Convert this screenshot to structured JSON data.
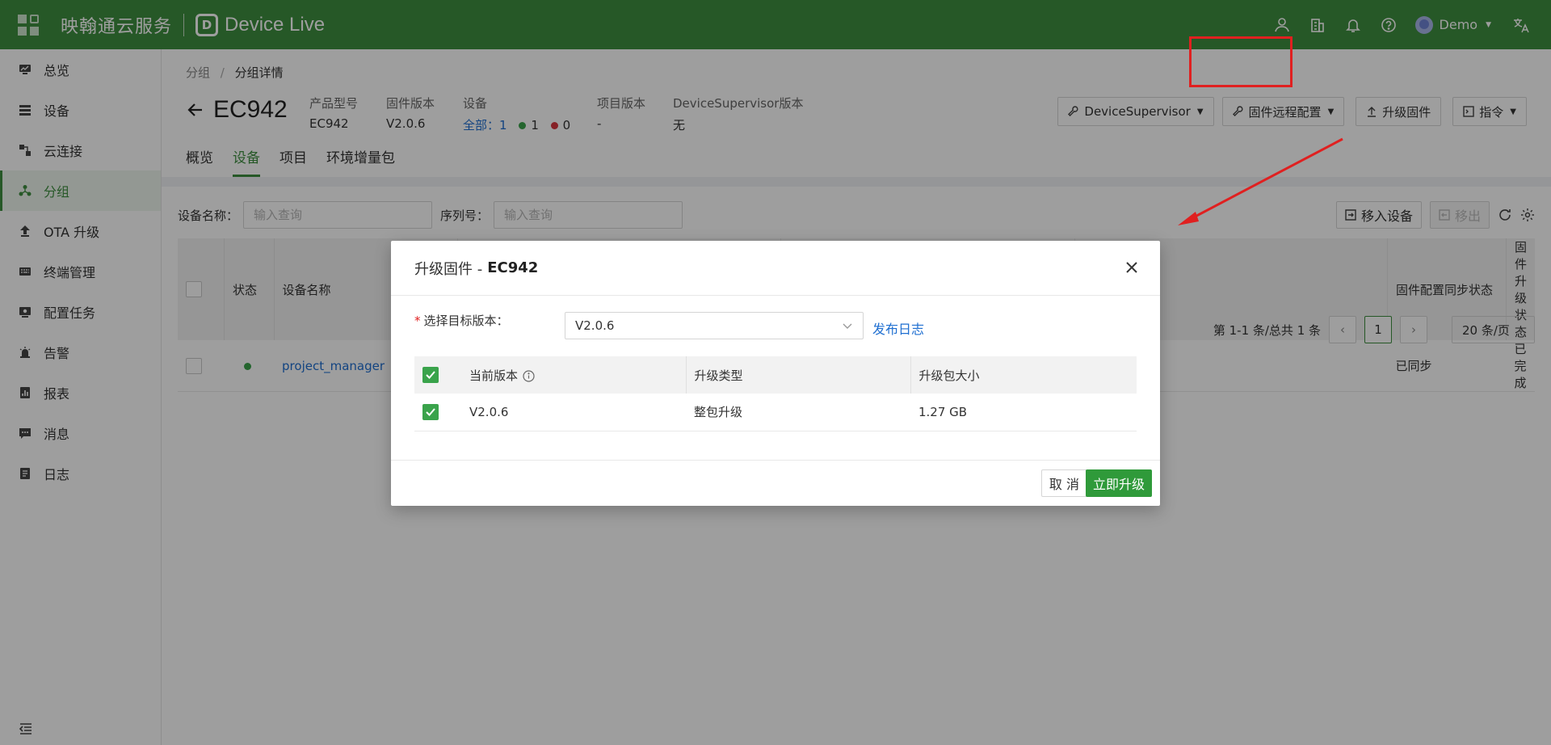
{
  "header": {
    "brand": "映翰通云服务",
    "logo_letter": "D",
    "product": "Device Live",
    "user": "Demo"
  },
  "sidebar": {
    "items": [
      {
        "label": "总览",
        "icon": "monitor-icon"
      },
      {
        "label": "设备",
        "icon": "server-icon"
      },
      {
        "label": "云连接",
        "icon": "link-icon"
      },
      {
        "label": "分组",
        "icon": "group-icon"
      },
      {
        "label": "OTA 升级",
        "icon": "upload-icon"
      },
      {
        "label": "终端管理",
        "icon": "keyboard-icon"
      },
      {
        "label": "配置任务",
        "icon": "config-icon"
      },
      {
        "label": "告警",
        "icon": "alarm-icon"
      },
      {
        "label": "报表",
        "icon": "report-icon"
      },
      {
        "label": "消息",
        "icon": "message-icon"
      },
      {
        "label": "日志",
        "icon": "log-icon"
      }
    ],
    "active_index": 3
  },
  "breadcrumb": {
    "parent": "分组",
    "current": "分组详情"
  },
  "page": {
    "title": "EC942",
    "meta": {
      "model_label": "产品型号",
      "model_value": "EC942",
      "fw_label": "固件版本",
      "fw_value": "V2.0.6",
      "device_label": "设备",
      "device_all": "全部：1",
      "device_online": "1",
      "device_offline": "0",
      "project_label": "项目版本",
      "project_value": "-",
      "ds_label": "DeviceSupervisor版本",
      "ds_value": "无"
    },
    "actions": {
      "device_supervisor": "DeviceSupervisor",
      "remote_config": "固件远程配置",
      "upgrade": "升级固件",
      "command": "指令"
    },
    "tabs": [
      "概览",
      "设备",
      "项目",
      "环境增量包"
    ],
    "active_tab": 1
  },
  "filters": {
    "name_label": "设备名称：",
    "name_placeholder": "输入查询",
    "sn_label": "序列号：",
    "sn_placeholder": "输入查询",
    "move_in": "移入设备",
    "move_out": "移出"
  },
  "table": {
    "headers": {
      "status": "状态",
      "name": "设备名称",
      "fw_sync": "固件配置同步状态",
      "fw_upgrade": "固件升级状态"
    },
    "rows": [
      {
        "name": "project_manager",
        "fw_sync": "已同步",
        "fw_upgrade": "已完成"
      }
    ]
  },
  "pager": {
    "summary": "第 1-1 条/总共 1 条",
    "page": "1",
    "size": "20 条/页"
  },
  "modal": {
    "title_prefix": "升级固件 -",
    "title_device": "EC942",
    "target_label": "选择目标版本：",
    "target_value": "V2.0.6",
    "release_log": "发布日志",
    "headers": {
      "current": "当前版本",
      "type": "升级类型",
      "size": "升级包大小"
    },
    "rows": [
      {
        "version": "V2.0.6",
        "type": "整包升级",
        "size": "1.27 GB"
      }
    ],
    "cancel": "取 消",
    "confirm": "立即升级"
  },
  "colors": {
    "brand_green": "#3e8e3f",
    "link_blue": "#1f6fd1",
    "highlight_red": "#e02020",
    "online": "#3aa34b",
    "offline": "#d9363e"
  }
}
